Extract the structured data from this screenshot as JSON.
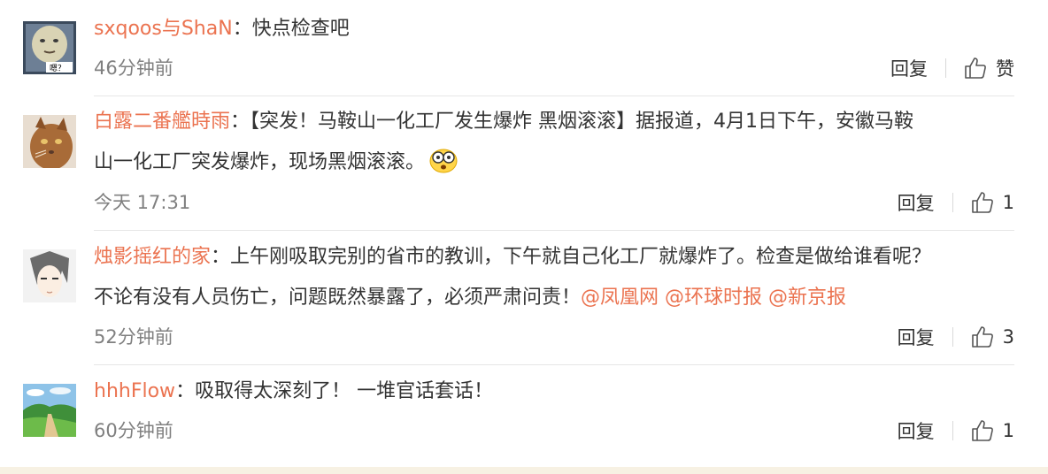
{
  "comments": [
    {
      "username": "sxqoos与ShaN",
      "separator": "：",
      "text": "快点检查吧",
      "time": "46分钟前",
      "reply_label": "回复",
      "like_label": "赞",
      "avatar_text": "嗯？"
    },
    {
      "username": "白露二番艦時雨",
      "separator": "：",
      "text_line1": "【突发！马鞍山一化工厂发生爆炸 黑烟滚滚】据报道，4月1日下午，安徽马鞍",
      "text_line2": "山一化工厂突发爆炸，现场黑烟滚滚。",
      "time": "今天 17:31",
      "reply_label": "回复",
      "like_count": "1"
    },
    {
      "username": "烛影摇红的家",
      "separator": "：",
      "text_line1": "上午刚吸取完别的省市的教训，下午就自己化工厂就爆炸了。检查是做给谁看呢？",
      "text_line2": "不论有没有人员伤亡，问题既然暴露了，必须严肃问责！",
      "mentions": [
        "@凤凰网",
        "@环球时报",
        "@新京报"
      ],
      "time": "52分钟前",
      "reply_label": "回复",
      "like_count": "3"
    },
    {
      "username": "hhhFlow",
      "separator": "：",
      "text": "吸取得太深刻了！ 一堆官话套话！",
      "time": "60分钟前",
      "reply_label": "回复",
      "like_count": "1"
    }
  ],
  "colors": {
    "username": "#eb7350",
    "text": "#333333",
    "meta": "#808080",
    "divider": "#e6e6e6"
  },
  "icons": [
    "thumbs-up-icon",
    "surprised-emoji-icon"
  ]
}
